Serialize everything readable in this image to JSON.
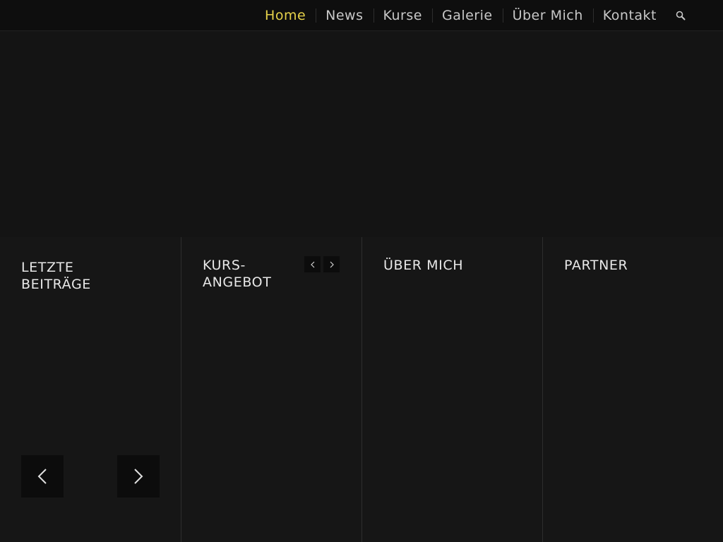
{
  "nav": {
    "items": [
      {
        "label": "Home",
        "active": true
      },
      {
        "label": "News",
        "active": false
      },
      {
        "label": "Kurse",
        "active": false
      },
      {
        "label": "Galerie",
        "active": false
      },
      {
        "label": "Über Mich",
        "active": false
      },
      {
        "label": "Kontakt",
        "active": false
      }
    ],
    "search_icon": "search-icon"
  },
  "columns": {
    "latest": {
      "title_line1": "LETZTE",
      "title_line2": "BEITRÄGE"
    },
    "courses": {
      "title_line1": "KURS-",
      "title_line2": "ANGEBOT"
    },
    "about": {
      "title": "ÜBER MICH"
    },
    "partner": {
      "title": "PARTNER"
    }
  },
  "colors": {
    "accent": "#e6d24a",
    "nav_text": "#c8c8c8",
    "background": "#161616",
    "topbar": "#0e0e0e"
  }
}
